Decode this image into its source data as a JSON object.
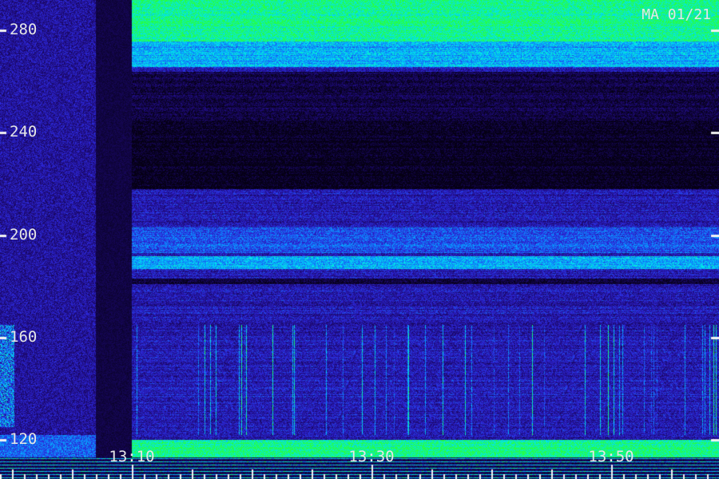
{
  "stamp": "MA 01/21",
  "chart_data": {
    "type": "heatmap",
    "title": "",
    "xlabel": "",
    "ylabel": "",
    "x_ticks": [
      {
        "label": "13:10",
        "minutes": 790
      },
      {
        "label": "13:30",
        "minutes": 810
      },
      {
        "label": "13:50",
        "minutes": 830
      }
    ],
    "xlim_minutes": [
      779,
      839
    ],
    "y_ticks": [
      120,
      160,
      200,
      240,
      280
    ],
    "ylim": [
      113,
      292
    ],
    "colors": {
      "low": "#05001a",
      "mid": "#2a1fb5",
      "cyan": "#00d8ff",
      "high": "#28ff3c"
    },
    "bands": [
      {
        "y_from": 276,
        "y_to": 292,
        "level": "high"
      },
      {
        "y_from": 266,
        "y_to": 276,
        "level": "cyan"
      },
      {
        "y_from": 245,
        "y_to": 264,
        "level": "low"
      },
      {
        "y_from": 218,
        "y_to": 245,
        "level": "very-low"
      },
      {
        "y_from": 193,
        "y_to": 203,
        "level": "mid-cyan"
      },
      {
        "y_from": 187,
        "y_to": 192,
        "level": "cyan"
      },
      {
        "y_from": 181,
        "y_to": 183,
        "level": "low"
      },
      {
        "y_from": 113,
        "y_to": 120,
        "level": "high"
      }
    ],
    "gap_minutes": [
      787,
      790
    ]
  }
}
